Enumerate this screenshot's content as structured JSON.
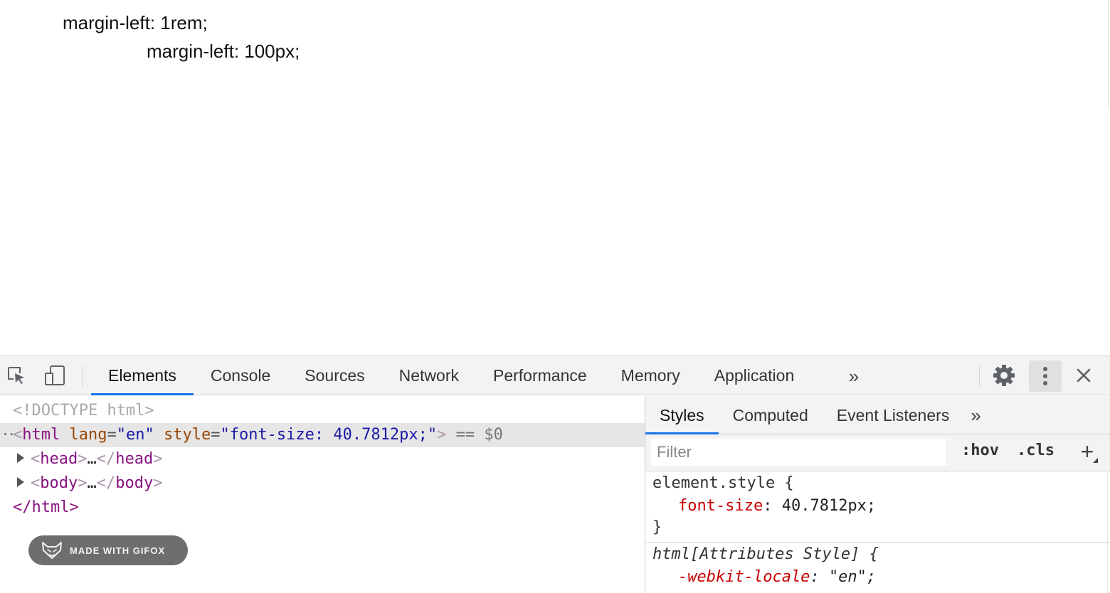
{
  "viewport": {
    "line_1": "margin-left: 1rem;",
    "line_2": "margin-left: 100px;"
  },
  "devtools": {
    "toolbar": {
      "tabs": [
        {
          "label": "Elements",
          "active": true
        },
        {
          "label": "Console"
        },
        {
          "label": "Sources"
        },
        {
          "label": "Network"
        },
        {
          "label": "Performance"
        },
        {
          "label": "Memory"
        },
        {
          "label": "Application"
        }
      ],
      "more_tabs_glyph": "»",
      "icons": [
        "inspect-element-icon",
        "device-toolbar-icon",
        "gear-icon",
        "kebab-menu-icon",
        "close-icon"
      ]
    },
    "dom_tree": {
      "doctype": "<!DOCTYPE html>",
      "html_tag": "html",
      "html_attr_lang_name": "lang",
      "html_attr_lang_value": "en",
      "html_attr_style_name": "style",
      "html_attr_style_value": "font-size: 40.7812px;",
      "selected_marker": "== $0",
      "head_tag": "head",
      "body_tag": "body",
      "collapsed_ellipsis": "…",
      "html_close": "</html>"
    },
    "badge": {
      "label": "MADE WITH GIFOX"
    },
    "sidebar": {
      "tabs": [
        {
          "label": "Styles",
          "active": true
        },
        {
          "label": "Computed"
        },
        {
          "label": "Event Listeners"
        }
      ],
      "more_tabs_glyph": "»",
      "filter_placeholder": "Filter",
      "hov_label": ":hov",
      "cls_label": ".cls",
      "add_rule_glyph": "+",
      "rules": [
        {
          "selector": "element.style {",
          "property": "font-size",
          "value": "40.7812px;",
          "close": "}"
        },
        {
          "selector": "html[Attributes Style] {",
          "property": "-webkit-locale",
          "value": "\"en\";"
        }
      ]
    },
    "colors": {
      "accent": "#1a73e8",
      "tag": "#881280",
      "attr_name": "#994500",
      "attr_value": "#1a1aa6",
      "css_property": "#c80000"
    }
  }
}
